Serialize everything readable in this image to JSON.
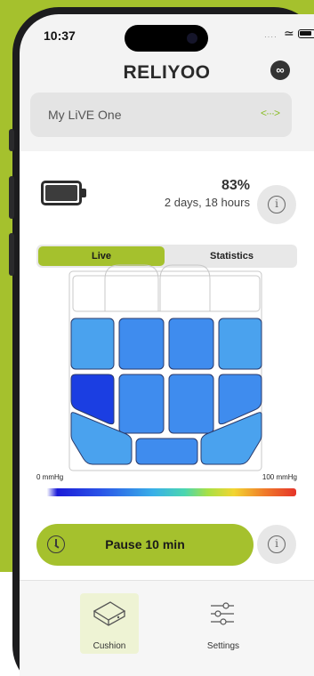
{
  "status_bar": {
    "time": "10:37"
  },
  "header": {
    "logo": "RELIYOO",
    "link_button_glyph": "∞"
  },
  "device": {
    "name": "My LiVE One",
    "connection_icon": "<···>"
  },
  "battery": {
    "percent": "83%",
    "time_remaining": "2 days, 18 hours"
  },
  "tabs": [
    {
      "label": "Live",
      "active": true
    },
    {
      "label": "Statistics",
      "active": false
    }
  ],
  "heatmap": {
    "cells": [
      {
        "id": "r1c1",
        "color": "#4aa2ee"
      },
      {
        "id": "r1c2",
        "color": "#3f8cee"
      },
      {
        "id": "r1c3",
        "color": "#3f8cee"
      },
      {
        "id": "r1c4",
        "color": "#4aa2ee"
      },
      {
        "id": "r2c1",
        "color": "#1b3ee2"
      },
      {
        "id": "r2c2",
        "color": "#3f8cee"
      },
      {
        "id": "r2c3",
        "color": "#3f8cee"
      },
      {
        "id": "r2c4",
        "color": "#3f8cee"
      },
      {
        "id": "r3c1",
        "color": "#4aa2ee"
      },
      {
        "id": "r3c2",
        "color": "#3f8cee"
      },
      {
        "id": "r3c3",
        "color": "#4aa2ee"
      }
    ]
  },
  "legend": {
    "min_label": "0 mmHg",
    "max_label": "100 mmHg"
  },
  "pause": {
    "label": "Pause 10 min"
  },
  "nav": [
    {
      "label": "Cushion",
      "icon": "cushion-icon",
      "active": true
    },
    {
      "label": "Settings",
      "icon": "sliders-icon",
      "active": false
    }
  ],
  "colors": {
    "accent": "#a5c12d",
    "background": "#f3f3f3"
  }
}
